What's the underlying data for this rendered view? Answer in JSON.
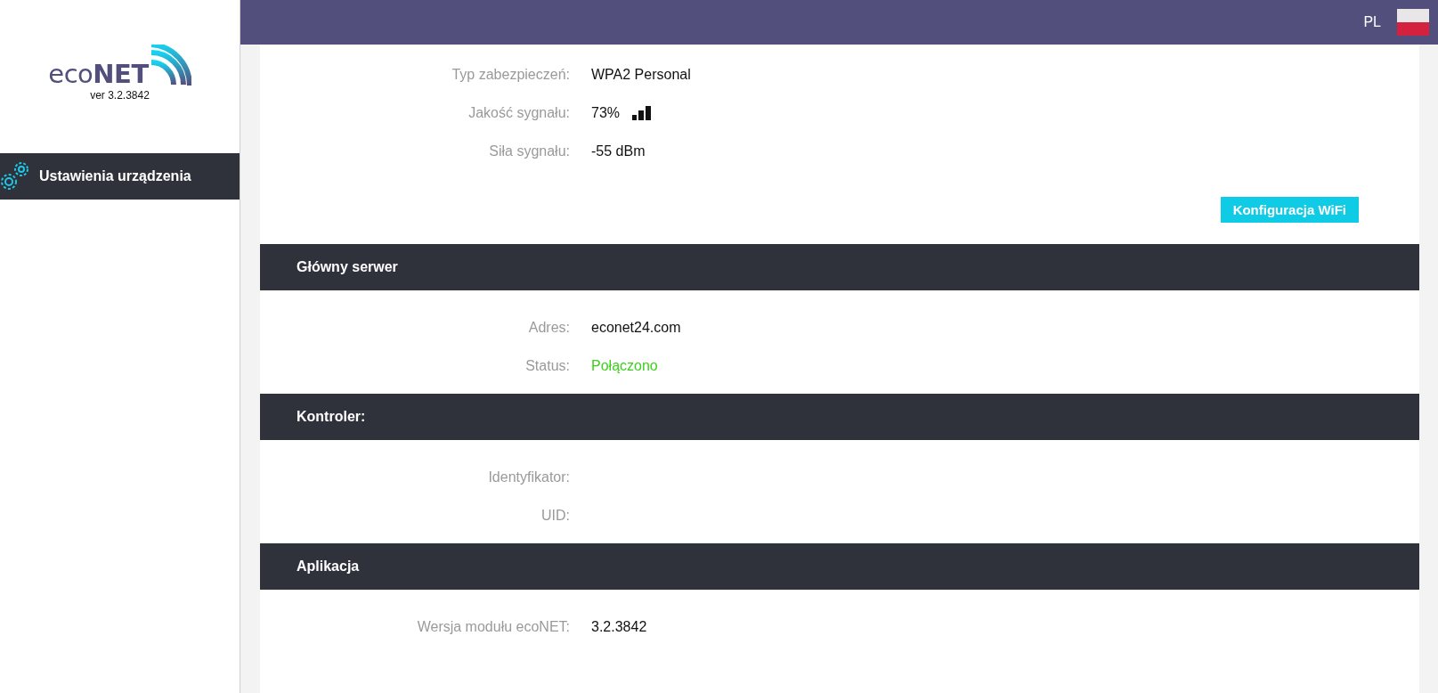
{
  "topbar": {
    "language": "PL"
  },
  "sidebar": {
    "logo": {
      "light": "eco",
      "bold": "NET",
      "version": "ver 3.2.3842"
    },
    "items": [
      {
        "label": "Ustawienia urządzenia",
        "selected": true
      }
    ]
  },
  "sections": [
    {
      "rows": [
        {
          "label": "Typ zabezpieczeń:",
          "value": "WPA2 Personal",
          "kind": "text"
        },
        {
          "label": "Jakość sygnału:",
          "value": "73%",
          "kind": "signal"
        },
        {
          "label": "Siła sygnału:",
          "value": "-55 dBm",
          "kind": "text"
        }
      ],
      "button": "Konfiguracja WiFi"
    },
    {
      "title": "Główny serwer",
      "rows": [
        {
          "label": "Adres:",
          "value": "econet24.com",
          "kind": "text"
        },
        {
          "label": "Status:",
          "value": "Połączono",
          "kind": "status"
        }
      ]
    },
    {
      "title": "Kontroler:",
      "rows": [
        {
          "label": "Identyfikator:",
          "kind": "text"
        },
        {
          "label": "UID:",
          "kind": "text"
        }
      ]
    },
    {
      "title": "Aplikacja",
      "rows": [
        {
          "label": "Wersja modułu ecoNET:",
          "value": "3.2.3842",
          "kind": "text"
        }
      ]
    }
  ]
}
